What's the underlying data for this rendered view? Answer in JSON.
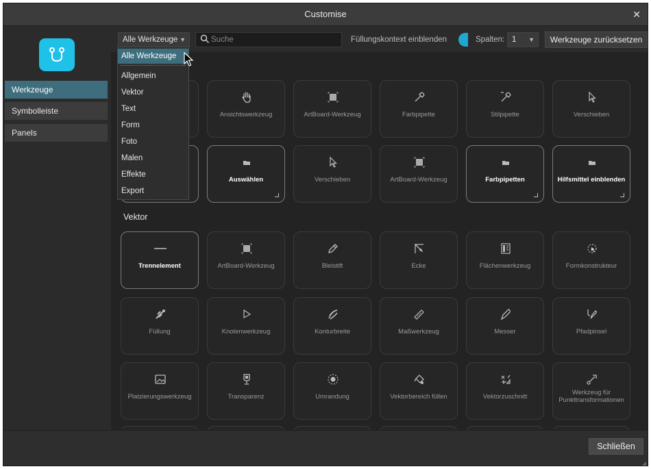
{
  "window": {
    "title": "Customise",
    "close": "✕"
  },
  "sidebar": {
    "items": [
      "Werkzeuge",
      "Symbolleiste",
      "Panels"
    ]
  },
  "toolbar": {
    "category_select": "Alle Werkzeuge",
    "search_placeholder": "Suche",
    "fill_context_label": "Füllungskontext einblenden",
    "columns_label": "Spalten:",
    "columns_value": "1",
    "reset_button": "Werkzeuge zurücksetzen"
  },
  "dropdown": {
    "items": [
      "Alle Werkzeuge",
      "Allgemein",
      "Vektor",
      "Text",
      "Form",
      "Foto",
      "Malen",
      "Effekte",
      "Export"
    ]
  },
  "sections": {
    "general_row1": [
      "",
      "Ansichtswerkzeug",
      "ArtBoard-Werkzeug",
      "Farbpipette",
      "Stilpipette",
      "Verschieben"
    ],
    "general_row2": [
      "",
      "Auswählen",
      "Verschieben",
      "ArtBoard-Werkzeug",
      "Farbpipetten",
      "Hilfsmittel einblenden"
    ],
    "vector_label": "Vektor",
    "vector_row1": [
      "Trennelement",
      "ArtBoard-Werkzeug",
      "Bleistift",
      "Ecke",
      "Flächenwerkzeug",
      "Formkonstrukteur"
    ],
    "vector_row2": [
      "Füllung",
      "Knotenwerkzeug",
      "Konturbreite",
      "Maßwerkzeug",
      "Messer",
      "Pfadpinsel"
    ],
    "vector_row3": [
      "Platzierungswerkzeug",
      "Transparenz",
      "Umrandung",
      "Vektorbereich füllen",
      "Vektorzuschnitt",
      "Werkzeug für Punkttransformationen"
    ]
  },
  "footer": {
    "close_button": "Schließen"
  }
}
